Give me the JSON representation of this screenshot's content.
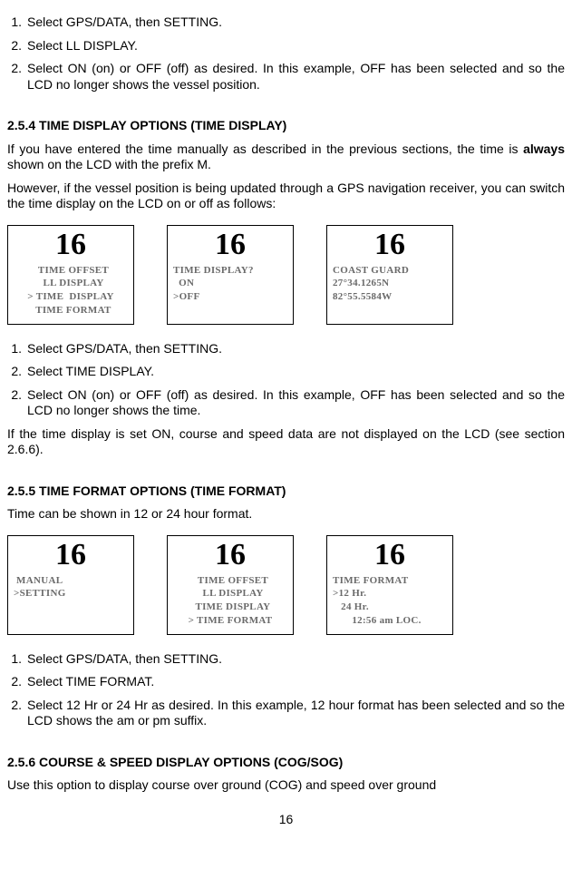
{
  "section_a": {
    "steps": [
      {
        "n": "1.",
        "txt": "Select GPS/DATA, then SETTING."
      },
      {
        "n": "2.",
        "txt": "Select LL DISPLAY."
      },
      {
        "n": "2.",
        "txt": "Select ON (on) or OFF (off) as desired. In this example, OFF has been selected and so the LCD no longer shows the vessel position."
      }
    ]
  },
  "section_254": {
    "heading": "2.5.4 TIME DISPLAY OPTIONS (TIME DISPLAY)",
    "p1a": "If you have entered the time manually as described in the previous sections, the time is ",
    "p1b": "always",
    "p1c": " shown on the LCD with the prefix M.",
    "p2": "However, if the vessel position is being updated through a GPS navigation receiver, you can switch the time display on the LCD on or off as follows:",
    "lcds": [
      {
        "big": "16",
        "lines": [
          "  TIME OFFSET",
          "  LL DISPLAY",
          "> TIME  DISPLAY",
          "  TIME FORMAT"
        ],
        "centered": true
      },
      {
        "big": "16",
        "lines": [
          "TIME DISPLAY?",
          "  ON",
          ">OFF"
        ]
      },
      {
        "big": "16",
        "lines": [
          "COAST GUARD",
          "",
          "27°34.1265N",
          "82°55.5584W"
        ]
      }
    ],
    "steps": [
      {
        "n": "1.",
        "txt": "Select GPS/DATA, then SETTING."
      },
      {
        "n": "2.",
        "txt": "Select TIME DISPLAY."
      },
      {
        "n": "2.",
        "txt": "Select ON (on) or OFF (off) as desired. In this example, OFF has been selected and so the LCD no longer shows the time."
      }
    ],
    "p3": "If the time display is set ON, course and speed data are not displayed on the LCD (see section 2.6.6)."
  },
  "section_255": {
    "heading": "2.5.5 TIME FORMAT OPTIONS (TIME FORMAT)",
    "p1": "Time can be shown in 12 or 24 hour format.",
    "lcds": [
      {
        "big": "16",
        "lines": [
          " MANUAL",
          ">SETTING"
        ]
      },
      {
        "big": "16",
        "lines": [
          "  TIME OFFSET",
          "  LL DISPLAY",
          "  TIME DISPLAY",
          "> TIME FORMAT"
        ],
        "centered": true
      },
      {
        "big": "16",
        "lines": [
          "TIME FORMAT",
          ">12 Hr.",
          "   24 Hr.",
          "       12:56 am LOC."
        ]
      }
    ],
    "steps": [
      {
        "n": "1.",
        "txt": "Select GPS/DATA, then SETTING."
      },
      {
        "n": "2.",
        "txt": "Select TIME FORMAT."
      },
      {
        "n": "2.",
        "txt": "Select 12 Hr or 24 Hr as desired. In this example, 12 hour format has been selected and so the LCD shows the am or pm suffix."
      }
    ]
  },
  "section_256": {
    "heading": "2.5.6 COURSE & SPEED DISPLAY OPTIONS (COG/SOG)",
    "p1": "Use this option to display course over ground (COG) and speed over ground"
  },
  "page_number": "16"
}
